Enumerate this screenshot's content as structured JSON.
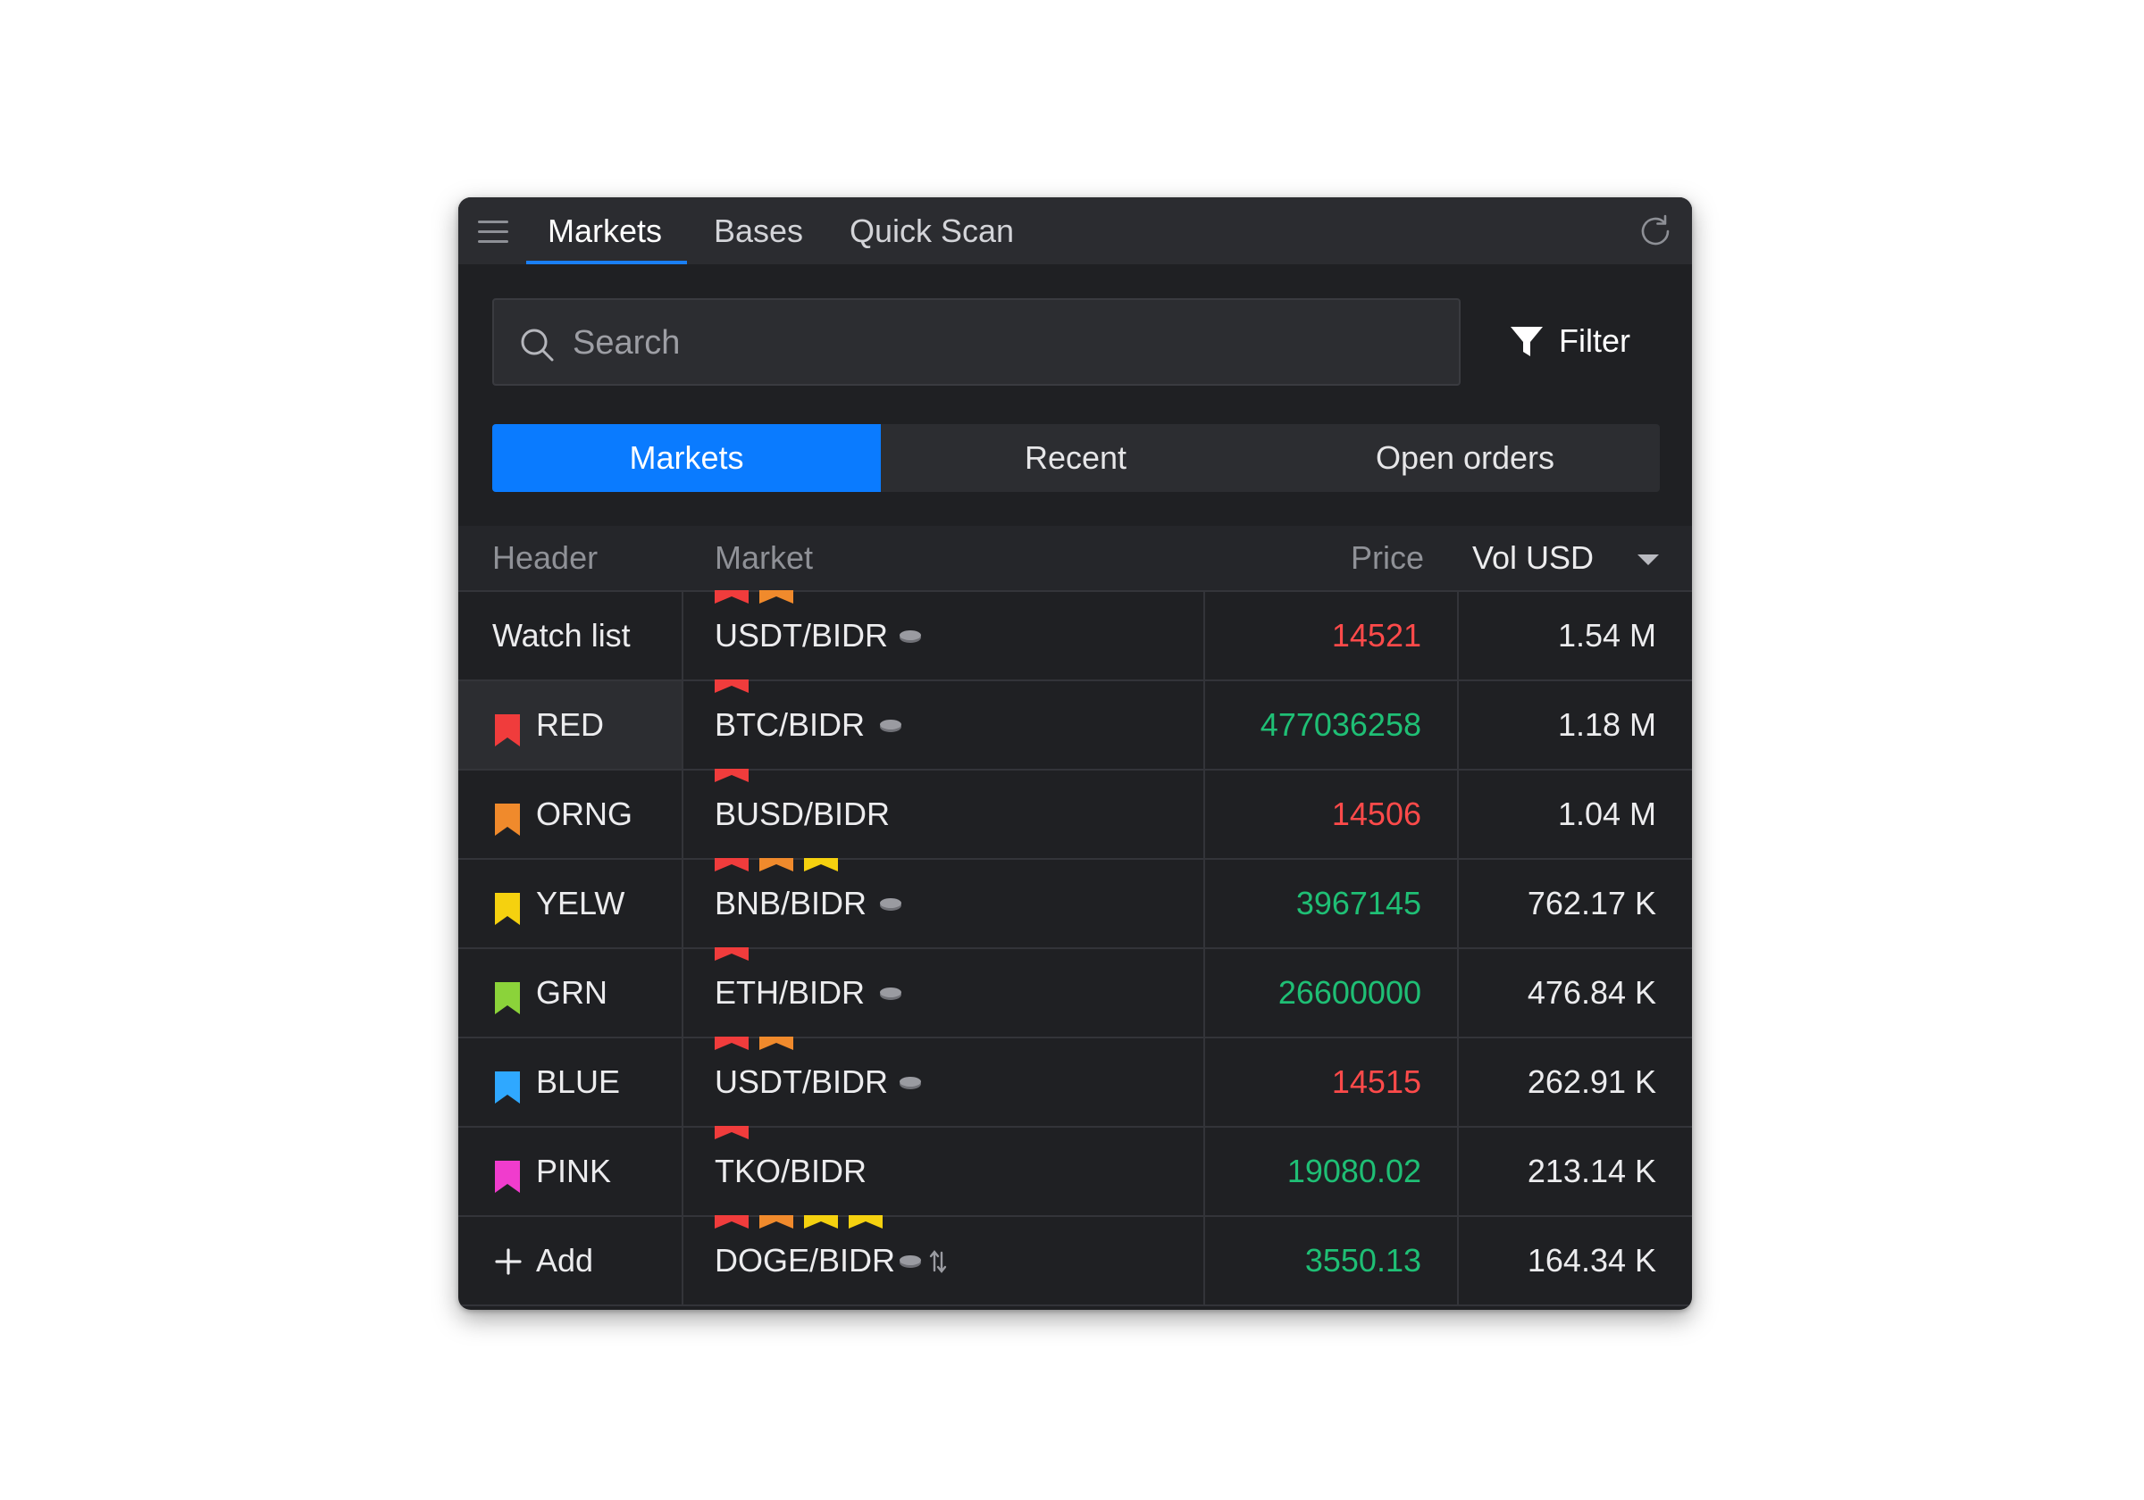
{
  "top_tabs": [
    "Markets",
    "Bases",
    "Quick Scan"
  ],
  "search": {
    "placeholder": "Search",
    "value": ""
  },
  "filter_label": "Filter",
  "segments": [
    "Markets",
    "Recent",
    "Open orders"
  ],
  "table_headers": {
    "header": "Header",
    "market": "Market",
    "price": "Price",
    "vol": "Vol USD"
  },
  "side_items": [
    {
      "label": "Watch list"
    },
    {
      "label": "RED",
      "color": "#f03c3c"
    },
    {
      "label": "ORNG",
      "color": "#f08a2c"
    },
    {
      "label": "YELW",
      "color": "#f5d10f"
    },
    {
      "label": "GRN",
      "color": "#8bd33a"
    },
    {
      "label": "BLUE",
      "color": "#2fa8ff"
    },
    {
      "label": "PINK",
      "color": "#f03ccd"
    },
    {
      "label": "Add",
      "icon": "plus-icon"
    }
  ],
  "rows": [
    {
      "market": "USDT/BIDR",
      "flags": [
        "red",
        "orange"
      ],
      "coin": true,
      "swap": false,
      "price": "14521",
      "trend": "down",
      "vol": "1.54 M"
    },
    {
      "market": "BTC/BIDR",
      "flags": [
        "red"
      ],
      "coin": true,
      "swap": false,
      "price": "477036258",
      "trend": "up",
      "vol": "1.18 M"
    },
    {
      "market": "BUSD/BIDR",
      "flags": [
        "red"
      ],
      "coin": false,
      "swap": false,
      "price": "14506",
      "trend": "down",
      "vol": "1.04 M"
    },
    {
      "market": "BNB/BIDR",
      "flags": [
        "red",
        "orange",
        "yellow"
      ],
      "coin": true,
      "swap": false,
      "price": "3967145",
      "trend": "up",
      "vol": "762.17 K"
    },
    {
      "market": "ETH/BIDR",
      "flags": [
        "red"
      ],
      "coin": true,
      "swap": false,
      "price": "26600000",
      "trend": "up",
      "vol": "476.84 K"
    },
    {
      "market": "USDT/BIDR",
      "flags": [
        "red",
        "orange"
      ],
      "coin": true,
      "swap": false,
      "price": "14515",
      "trend": "down",
      "vol": "262.91 K"
    },
    {
      "market": "TKO/BIDR",
      "flags": [
        "red"
      ],
      "coin": false,
      "swap": false,
      "price": "19080.02",
      "trend": "up",
      "vol": "213.14 K"
    },
    {
      "market": "DOGE/BIDR",
      "flags": [
        "red",
        "orange",
        "yellow",
        "yellow"
      ],
      "coin": true,
      "swap": true,
      "price": "3550.13",
      "trend": "up",
      "vol": "164.34 K"
    }
  ],
  "colors": {
    "accent": "#0a7bff",
    "price_up": "#1fbf75",
    "price_down": "#ff4a4a",
    "flag_red": "#f03c3c",
    "flag_orange": "#f08a2c",
    "flag_yellow": "#f5d10f"
  }
}
